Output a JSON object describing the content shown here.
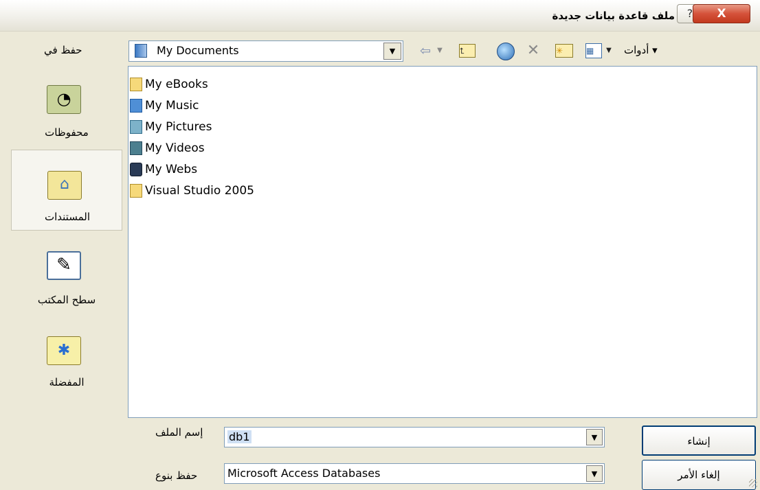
{
  "window": {
    "title": "ملف قاعدة بيانات جديدة"
  },
  "titlebar": {
    "close_glyph": "X",
    "help_glyph": "?"
  },
  "toolbar": {
    "save_in_label": "حفظ في",
    "location": "My Documents",
    "tools_label": "▾ أدوات"
  },
  "places": [
    {
      "label": "محفوظات",
      "icon": "history-icon"
    },
    {
      "label": "المستندات",
      "icon": "my-documents-icon",
      "selected": true
    },
    {
      "label": "سطح المكتب",
      "icon": "desktop-icon"
    },
    {
      "label": "المفضلة",
      "icon": "favorites-icon"
    }
  ],
  "files": [
    {
      "name": "My eBooks",
      "icon": "folder-icon"
    },
    {
      "name": "My Music",
      "icon": "music-folder-icon"
    },
    {
      "name": "My Pictures",
      "icon": "pictures-folder-icon"
    },
    {
      "name": "My Videos",
      "icon": "videos-folder-icon"
    },
    {
      "name": "My Webs",
      "icon": "webs-folder-icon"
    },
    {
      "name": "Visual Studio 2005",
      "icon": "folder-icon"
    }
  ],
  "filename": {
    "label": "إسم الملف",
    "value": "db1"
  },
  "filetype": {
    "label": "حفظ بنوع",
    "value": "Microsoft Access Databases"
  },
  "buttons": {
    "create": "إنشاء",
    "cancel": "إلغاء الأمر"
  },
  "colors": {
    "accent": "#7f9db9",
    "close": "#d5523a",
    "background": "#ece9d8"
  }
}
